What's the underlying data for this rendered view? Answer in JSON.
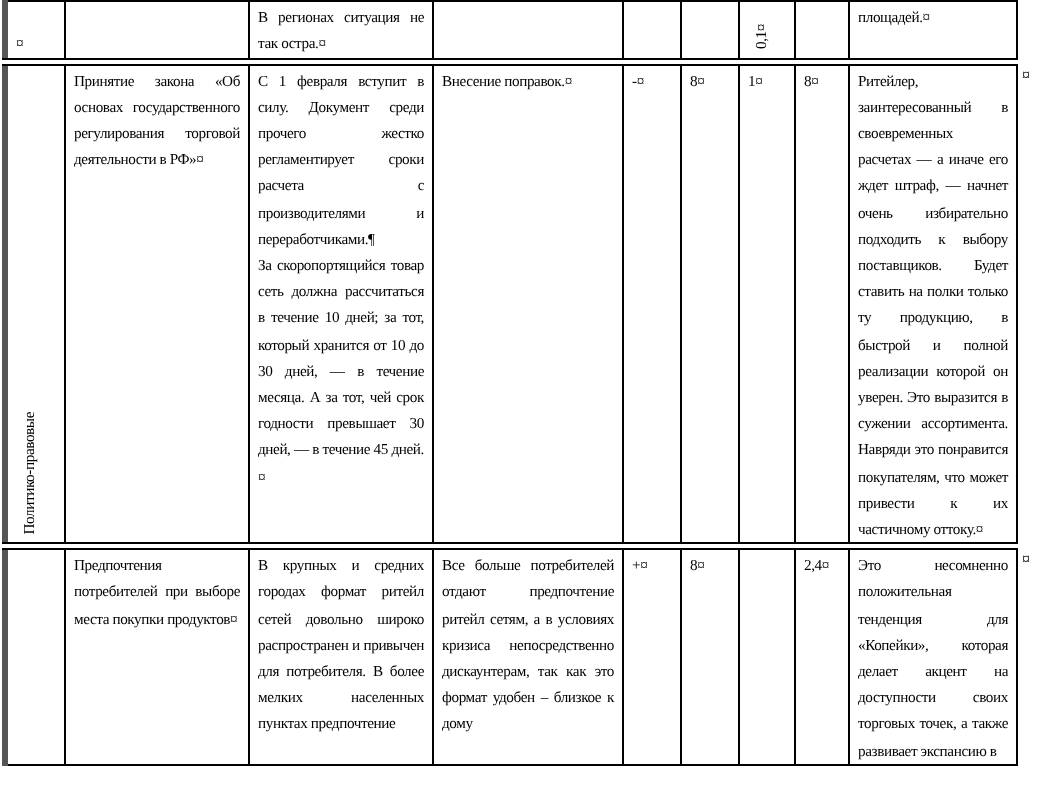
{
  "table": {
    "rows": [
      {
        "cells": [
          {
            "kind": "text",
            "text": "¤"
          },
          {},
          {
            "kind": "text",
            "text": "В регионах ситуация не так остра.¤"
          },
          {},
          {},
          {},
          {
            "kind": "vertical",
            "text": "0,1¤"
          },
          {},
          {
            "kind": "text",
            "text": "площадей.¤"
          }
        ]
      },
      {
        "cells": [
          {
            "kind": "vertical",
            "text": "Политико-правовые"
          },
          {
            "kind": "text",
            "text": "Принятие закона «Об основах государственного регулирования торговой деятельности в РФ»¤"
          },
          {
            "kind": "text",
            "text": "С 1 февраля вступит в силу. Документ среди прочего жестко регламентирует сроки расчета с производителями и переработчиками.¶\nЗа скоропортящийся товар сеть должна рассчитаться в течение 10 дней; за тот, который хранится от 10 до 30 дней, — в течение месяца. А за тот, чей срок годности превышает 30 дней, — в течение 45 дней.¤"
          },
          {
            "kind": "text",
            "text": "Внесение поправок.¤"
          },
          {
            "kind": "text",
            "text": "-¤"
          },
          {
            "kind": "text",
            "text": "8¤"
          },
          {
            "kind": "text",
            "text": "1¤"
          },
          {
            "kind": "text",
            "text": "8¤"
          },
          {
            "kind": "text",
            "text": "Ритейлер, заинтересованный в своевременных расчетах — а иначе его ждет штраф, — начнет очень избирательно подходить к выбору поставщиков. Будет ставить на полки только ту продукцию, в быстрой и полной реализации которой он уверен. Это выразится в сужении ассортимента. Навряди это понравится покупателям, что может привести к их частичному оттоку.¤"
          }
        ],
        "end_mark": "¤"
      },
      {
        "cells": [
          {},
          {
            "kind": "text",
            "text": "Предпочтения потребителей при выборе места покупки продуктов¤"
          },
          {
            "kind": "text",
            "text": "В крупных и средних городах формат ритейл сетей довольно широко распространен и привычен для потребителя. В более мелких населенных пунктах предпочтение"
          },
          {
            "kind": "text",
            "text": "Все больше потребителей отдают предпочтение ритейл сетям, а в условиях кризиса непосредственно дискаунтерам, так как это формат удобен – близкое к дому"
          },
          {
            "kind": "text",
            "text": "+¤"
          },
          {
            "kind": "text",
            "text": "8¤"
          },
          {},
          {
            "kind": "text",
            "text": "2,4¤"
          },
          {
            "kind": "text",
            "text": "Это несомненно положительная тенденция для «Копейки», которая делает акцент на доступности своих торговых точек, а также развивает экспансию в"
          }
        ],
        "end_mark": "¤"
      }
    ]
  }
}
